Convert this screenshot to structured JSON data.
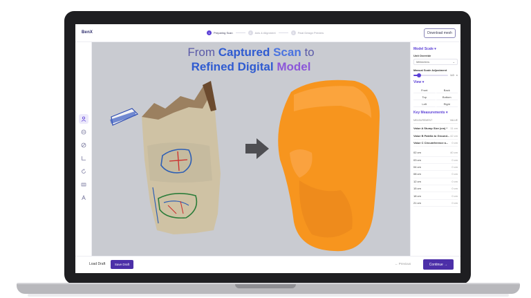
{
  "app": {
    "logo": "BenX"
  },
  "steps": [
    {
      "num": "1",
      "label": "Preparing Scan"
    },
    {
      "num": "2",
      "label": "Axis & Alignment"
    },
    {
      "num": "3",
      "label": "Final Design Preview"
    }
  ],
  "header": {
    "download_label": "Download mesh"
  },
  "headline": {
    "line1_pre": "From ",
    "line1_bold1": "Captured",
    "line1_bold2": "Scan",
    "line1_post": " to",
    "line2_bold1": "Refined",
    "line2_bold2": " Digital ",
    "line2_bold3": "Model"
  },
  "sidebar": {
    "icons": [
      "user-icon",
      "scan-icon",
      "target-icon",
      "measure-icon",
      "rotate-icon",
      "grid-icon",
      "person-icon"
    ]
  },
  "panel": {
    "model_scale_title": "Model Scale",
    "unit_override_label": "Unit Override",
    "unit_value": "Millimeters",
    "manual_scale_label": "Manual Scale Adjustment",
    "scale_value": "1.0",
    "scale_fraction": 0.15,
    "view_title": "View",
    "views": [
      "Front",
      "Back",
      "Top",
      "Bottom",
      "Left",
      "Right"
    ],
    "key_measurements_title": "Key Measurements",
    "meas_header": {
      "k": "MEASUREMENT",
      "v": "VALUE"
    },
    "measurements_primary": [
      {
        "k": "Value A Stump Size (cm) *",
        "v": "11 cm"
      },
      {
        "k": "Value B Patella to Ground...",
        "v": "42 cm"
      },
      {
        "k": "Value C Circumference a...",
        "v": "0 cm"
      }
    ],
    "measurements_secondary": [
      {
        "k": "02 cm",
        "v": "40 cm"
      },
      {
        "k": "03 cm",
        "v": "0 cm"
      },
      {
        "k": "04 cm",
        "v": "0 cm"
      },
      {
        "k": "08 cm",
        "v": "0 cm"
      },
      {
        "k": "12 cm",
        "v": "0 cm"
      },
      {
        "k": "15 cm",
        "v": "0 cm"
      },
      {
        "k": "18 cm",
        "v": "0 cm"
      },
      {
        "k": "21 cm",
        "v": "0 cm"
      }
    ]
  },
  "footer": {
    "load_draft": "Load Draft",
    "save_draft": "Save Draft",
    "previous": "← Previous",
    "continue": "Continue →"
  },
  "colors": {
    "accent": "#5b3fd6",
    "button": "#4c2fa8",
    "viewport_bg": "#c9cbd1",
    "model_orange": "#f7951e"
  }
}
